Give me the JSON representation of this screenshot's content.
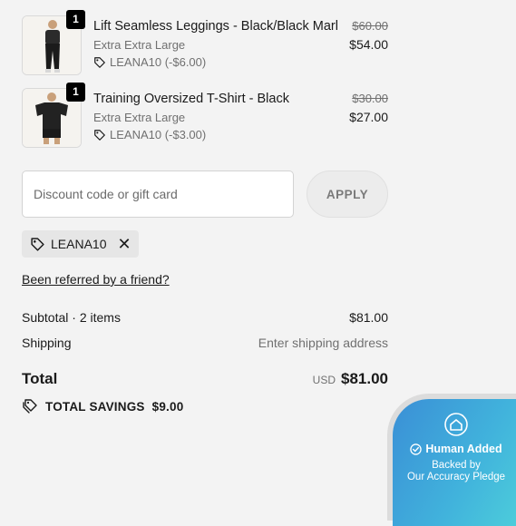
{
  "items": [
    {
      "name": "Lift Seamless Leggings - Black/Black Marl",
      "variant": "Extra Extra Large",
      "discount": "LEANA10 (-$6.00)",
      "original_price": "$60.00",
      "price": "$54.00",
      "quantity": "1"
    },
    {
      "name": "Training Oversized T-Shirt - Black",
      "variant": "Extra Extra Large",
      "discount": "LEANA10 (-$3.00)",
      "original_price": "$30.00",
      "price": "$27.00",
      "quantity": "1"
    }
  ],
  "discount": {
    "placeholder": "Discount code or gift card",
    "apply_label": "APPLY",
    "applied_code": "LEANA10"
  },
  "referral_link": "Been referred by a friend?",
  "summary": {
    "subtotal_label": "Subtotal · 2 items",
    "subtotal_value": "$81.00",
    "shipping_label": "Shipping",
    "shipping_value": "Enter shipping address",
    "total_label": "Total",
    "currency": "USD",
    "total_value": "$81.00",
    "savings_label": "TOTAL SAVINGS",
    "savings_value": "$9.00"
  },
  "badge": {
    "title": "Human Added",
    "line1": "Backed by",
    "line2": "Our Accuracy Pledge"
  },
  "icons": {
    "tag": "tag-icon",
    "close": "close-icon",
    "savings": "tags-icon",
    "check": "check-circle-icon",
    "logo": "house-logo-icon"
  },
  "colors": {
    "background": "#f3f3f3",
    "text": "#1a1a1a",
    "muted": "#707070",
    "badge_start": "#3a8fd6",
    "badge_end": "#4fd3da"
  }
}
